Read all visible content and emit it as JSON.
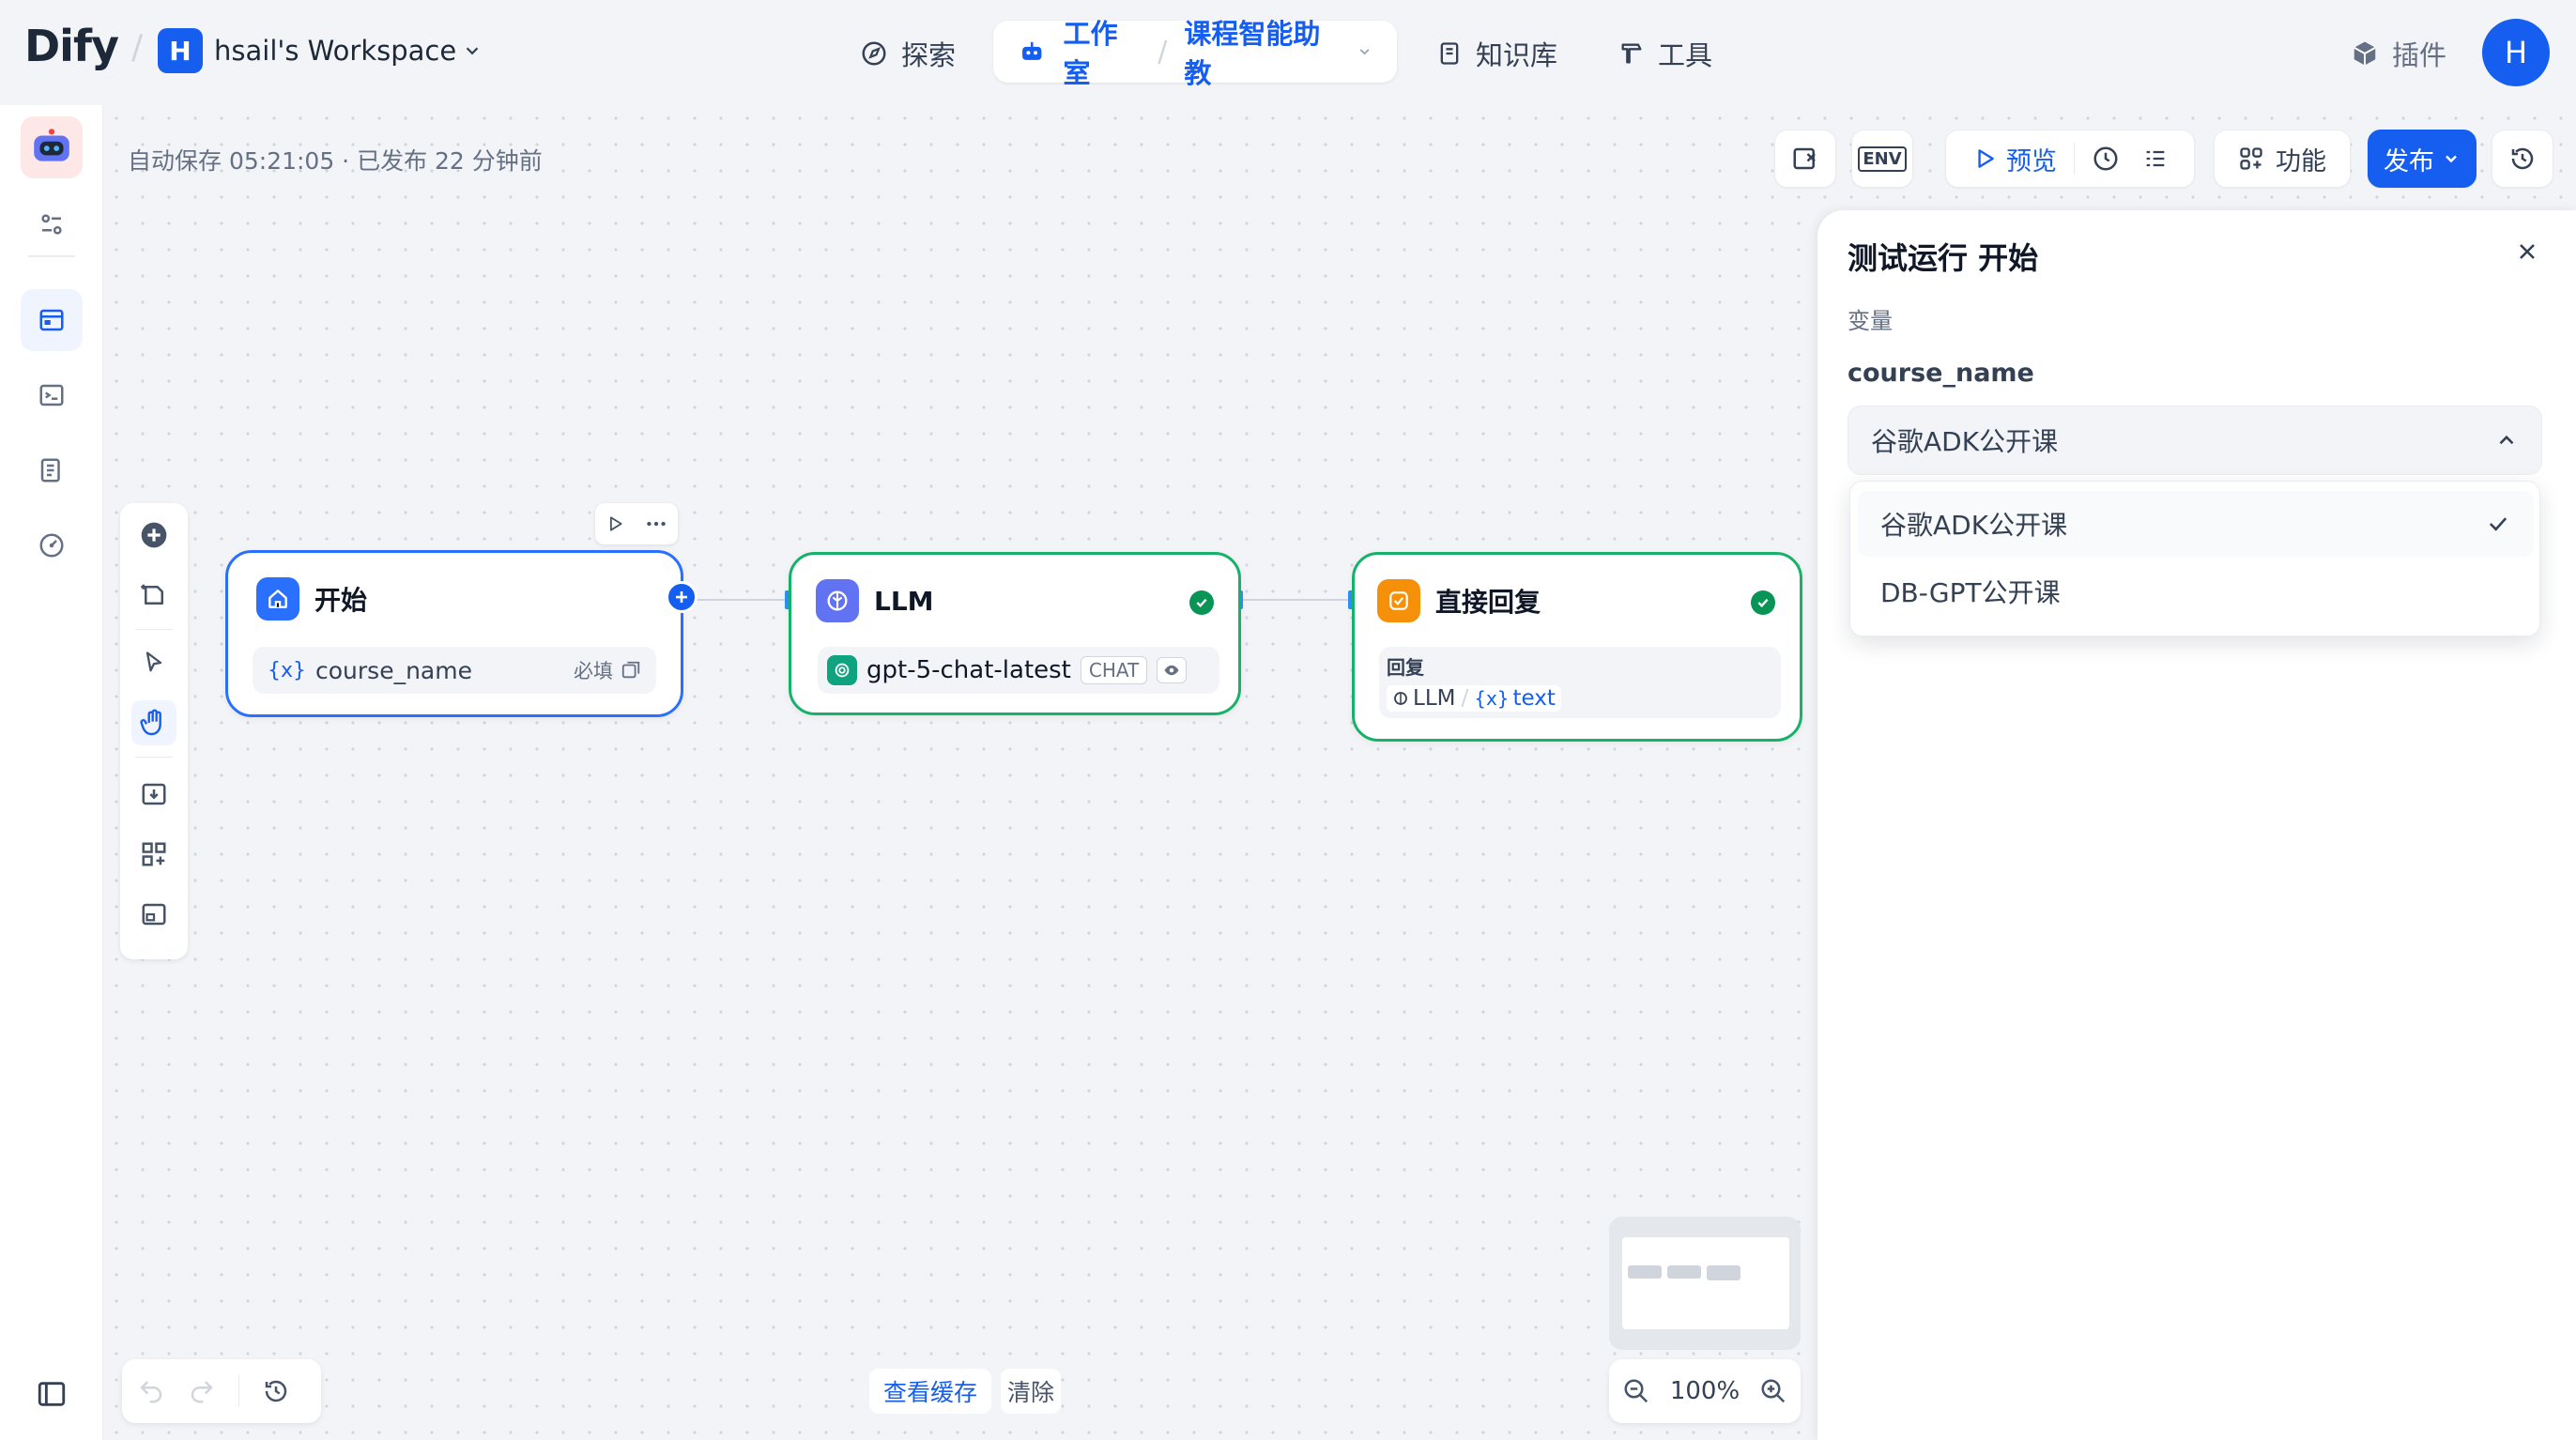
{
  "brand": {
    "logo": "Dify"
  },
  "workspace": {
    "initial": "H",
    "name": "hsail's Workspace"
  },
  "nav": {
    "explore": "探索",
    "studio": "工作室",
    "app_name": "课程智能助教",
    "knowledge": "知识库",
    "tools": "工具",
    "plugins": "插件"
  },
  "user": {
    "initial": "H"
  },
  "status": {
    "autosave": "自动保存 05:21:05 · 已发布 22 分钟前"
  },
  "toolbar": {
    "env": "ENV",
    "preview": "预览",
    "features": "功能",
    "publish": "发布"
  },
  "nodes": {
    "start": {
      "title": "开始",
      "var_name": "course_name",
      "required": "必填"
    },
    "llm": {
      "title": "LLM",
      "model": "gpt-5-chat-latest",
      "mode": "CHAT"
    },
    "answer": {
      "title": "直接回复",
      "label": "回复",
      "ref_node": "LLM",
      "ref_var": "text"
    }
  },
  "bottom": {
    "view_cache": "查看缓存",
    "clear": "清除",
    "zoom": "100%"
  },
  "panel": {
    "title": "测试运行 开始",
    "section": "变量",
    "field_label": "course_name",
    "selected_value": "谷歌ADK公开课",
    "options": [
      "谷歌ADK公开课",
      "DB-GPT公开课"
    ]
  },
  "colors": {
    "primary": "#155eef",
    "success": "#079455",
    "llm_icon": "#6172f3",
    "answer_icon": "#f79009"
  }
}
